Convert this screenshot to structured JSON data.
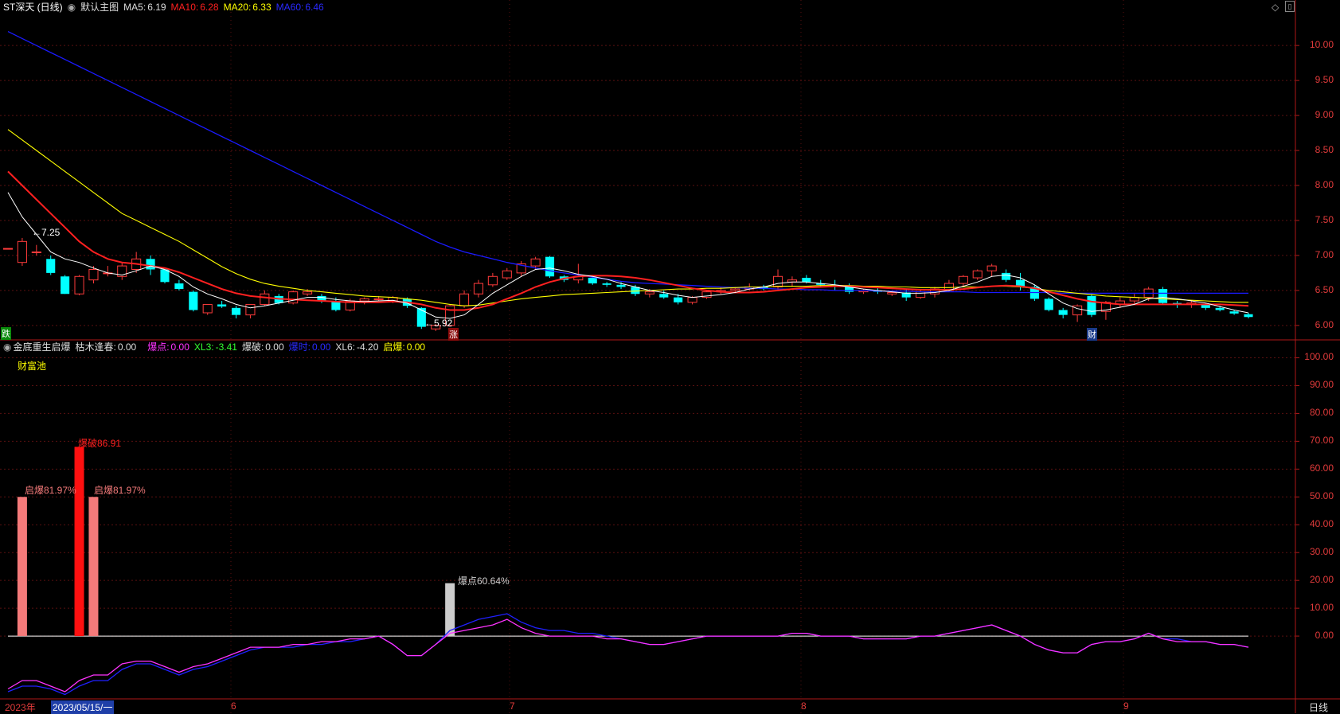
{
  "main_header": {
    "symbol": "ST深天 (日线)",
    "template_label": "默认主图",
    "ma5_label": "MA5:",
    "ma5_value": "6.19",
    "ma10_label": "MA10:",
    "ma10_value": "6.28",
    "ma20_label": "MA20:",
    "ma20_value": "6.33",
    "ma60_label": "MA60:",
    "ma60_value": "6.46"
  },
  "indicator_header": {
    "name": "金底重生启爆",
    "kumu_label": "枯木逢春:",
    "kumu_value": "0.00",
    "baodian_label": "爆点:",
    "baodian_value": "0.00",
    "xl3_label": "XL3:",
    "xl3_value": "-3.41",
    "baopo_label": "爆破:",
    "baopo_value": "0.00",
    "baoshi_label": "爆时:",
    "baoshi_value": "0.00",
    "xl6_label": "XL6:",
    "xl6_value": "-4.20",
    "qibao_label": "启爆:",
    "qibao_value": "0.00",
    "pool_label": "财富池"
  },
  "markers": {
    "high_price": "7.25",
    "low_price": "5.92",
    "left_badge": "跌",
    "zhang_badge": "涨",
    "cai_badge": "财"
  },
  "bar_labels": {
    "qibao1": "启爆81.97%",
    "baopo": "爆破86.91",
    "qibao2": "启爆81.97%",
    "baodian": "爆点60.64%"
  },
  "footer": {
    "year": "2023年",
    "date_cursor": "2023/05/15/一",
    "month6": "6",
    "month7": "7",
    "month8": "8",
    "month9": "9",
    "period": "日线"
  },
  "colors": {
    "up": "#ff3b3b",
    "down": "#00ffff",
    "ma5": "#ffffff",
    "ma10": "#ff2020",
    "ma20": "#ffff00",
    "ma60": "#1a1aff",
    "axis": "#b01818",
    "grid": "#5a1010"
  },
  "chart_data": [
    {
      "type": "candlestick",
      "title": "ST深天 (日线)",
      "y_axis_ticks": [
        "10.00",
        "9.50",
        "9.00",
        "8.50",
        "8.00",
        "7.50",
        "7.00",
        "6.50",
        "6.00"
      ],
      "ylim": [
        5.85,
        10.4
      ],
      "ohlc": [
        [
          7.1,
          7.1,
          7.1,
          7.1
        ],
        [
          6.9,
          7.25,
          6.85,
          7.2
        ],
        [
          7.05,
          7.15,
          7.0,
          7.05
        ],
        [
          6.95,
          7.0,
          6.72,
          6.75
        ],
        [
          6.7,
          6.72,
          6.45,
          6.45
        ],
        [
          6.45,
          6.72,
          6.43,
          6.7
        ],
        [
          6.65,
          6.85,
          6.6,
          6.8
        ],
        [
          6.75,
          6.85,
          6.7,
          6.75
        ],
        [
          6.7,
          6.9,
          6.65,
          6.85
        ],
        [
          6.8,
          7.05,
          6.75,
          6.95
        ],
        [
          6.95,
          7.0,
          6.72,
          6.8
        ],
        [
          6.8,
          6.8,
          6.6,
          6.62
        ],
        [
          6.6,
          6.65,
          6.5,
          6.52
        ],
        [
          6.48,
          6.5,
          6.2,
          6.22
        ],
        [
          6.18,
          6.3,
          6.15,
          6.3
        ],
        [
          6.3,
          6.35,
          6.25,
          6.27
        ],
        [
          6.25,
          6.28,
          6.1,
          6.15
        ],
        [
          6.15,
          6.3,
          6.1,
          6.3
        ],
        [
          6.3,
          6.5,
          6.28,
          6.45
        ],
        [
          6.42,
          6.45,
          6.3,
          6.32
        ],
        [
          6.32,
          6.5,
          6.3,
          6.48
        ],
        [
          6.45,
          6.52,
          6.42,
          6.48
        ],
        [
          6.42,
          6.45,
          6.32,
          6.35
        ],
        [
          6.35,
          6.4,
          6.2,
          6.22
        ],
        [
          6.22,
          6.38,
          6.2,
          6.35
        ],
        [
          6.35,
          6.4,
          6.3,
          6.38
        ],
        [
          6.38,
          6.42,
          6.35,
          6.38
        ],
        [
          6.35,
          6.42,
          6.32,
          6.4
        ],
        [
          6.38,
          6.4,
          6.25,
          6.28
        ],
        [
          6.25,
          6.26,
          5.95,
          5.98
        ],
        [
          5.95,
          6.02,
          5.92,
          6.0
        ],
        [
          6.0,
          6.3,
          5.98,
          6.28
        ],
        [
          6.28,
          6.5,
          6.25,
          6.45
        ],
        [
          6.45,
          6.65,
          6.4,
          6.6
        ],
        [
          6.58,
          6.75,
          6.55,
          6.7
        ],
        [
          6.68,
          6.82,
          6.65,
          6.78
        ],
        [
          6.75,
          6.92,
          6.7,
          6.88
        ],
        [
          6.85,
          6.98,
          6.8,
          6.95
        ],
        [
          6.98,
          6.99,
          6.68,
          6.7
        ],
        [
          6.7,
          6.72,
          6.62,
          6.65
        ],
        [
          6.65,
          6.88,
          6.6,
          6.7
        ],
        [
          6.68,
          6.7,
          6.58,
          6.6
        ],
        [
          6.6,
          6.62,
          6.55,
          6.58
        ],
        [
          6.58,
          6.62,
          6.52,
          6.55
        ],
        [
          6.55,
          6.58,
          6.42,
          6.45
        ],
        [
          6.45,
          6.52,
          6.4,
          6.48
        ],
        [
          6.45,
          6.5,
          6.38,
          6.4
        ],
        [
          6.4,
          6.45,
          6.3,
          6.33
        ],
        [
          6.33,
          6.42,
          6.3,
          6.4
        ],
        [
          6.4,
          6.5,
          6.38,
          6.48
        ],
        [
          6.48,
          6.55,
          6.45,
          6.5
        ],
        [
          6.5,
          6.55,
          6.48,
          6.52
        ],
        [
          6.52,
          6.6,
          6.5,
          6.55
        ],
        [
          6.55,
          6.58,
          6.5,
          6.52
        ],
        [
          6.55,
          6.8,
          6.5,
          6.7
        ],
        [
          6.62,
          6.7,
          6.55,
          6.65
        ],
        [
          6.68,
          6.72,
          6.6,
          6.62
        ],
        [
          6.6,
          6.65,
          6.55,
          6.58
        ],
        [
          6.58,
          6.65,
          6.5,
          6.55
        ],
        [
          6.55,
          6.6,
          6.45,
          6.48
        ],
        [
          6.48,
          6.52,
          6.45,
          6.5
        ],
        [
          6.5,
          6.55,
          6.45,
          6.48
        ],
        [
          6.45,
          6.5,
          6.42,
          6.47
        ],
        [
          6.47,
          6.52,
          6.35,
          6.4
        ],
        [
          6.4,
          6.5,
          6.38,
          6.48
        ],
        [
          6.45,
          6.55,
          6.4,
          6.52
        ],
        [
          6.5,
          6.65,
          6.48,
          6.6
        ],
        [
          6.6,
          6.72,
          6.55,
          6.7
        ],
        [
          6.68,
          6.8,
          6.65,
          6.78
        ],
        [
          6.78,
          6.88,
          6.7,
          6.85
        ],
        [
          6.75,
          6.8,
          6.62,
          6.65
        ],
        [
          6.65,
          6.75,
          6.5,
          6.55
        ],
        [
          6.55,
          6.58,
          6.35,
          6.38
        ],
        [
          6.38,
          6.4,
          6.2,
          6.22
        ],
        [
          6.22,
          6.25,
          6.1,
          6.15
        ],
        [
          6.15,
          6.3,
          6.05,
          6.28
        ],
        [
          6.42,
          6.45,
          6.12,
          6.15
        ],
        [
          6.2,
          6.35,
          6.08,
          6.33
        ],
        [
          6.3,
          6.4,
          6.25,
          6.35
        ],
        [
          6.35,
          6.45,
          6.3,
          6.4
        ],
        [
          6.4,
          6.55,
          6.35,
          6.52
        ],
        [
          6.52,
          6.55,
          6.3,
          6.32
        ],
        [
          6.32,
          6.35,
          6.25,
          6.3
        ],
        [
          6.3,
          6.35,
          6.25,
          6.32
        ],
        [
          6.3,
          6.32,
          6.22,
          6.25
        ],
        [
          6.25,
          6.28,
          6.2,
          6.22
        ],
        [
          6.2,
          6.22,
          6.15,
          6.17
        ],
        [
          6.16,
          6.18,
          6.1,
          6.12
        ]
      ],
      "ma5_approx": [
        7.9,
        7.55,
        7.3,
        7.05,
        6.95,
        6.9,
        6.82,
        6.75,
        6.72,
        6.78,
        6.85,
        6.8,
        6.7,
        6.55,
        6.45,
        6.38,
        6.3,
        6.25,
        6.28,
        6.32,
        6.36,
        6.4,
        6.4,
        6.37,
        6.35,
        6.34,
        6.35,
        6.36,
        6.32,
        6.22,
        6.12,
        6.1,
        6.15,
        6.3,
        6.46,
        6.58,
        6.7,
        6.8,
        6.82,
        6.78,
        6.73,
        6.7,
        6.66,
        6.6,
        6.55,
        6.5,
        6.47,
        6.43,
        6.4,
        6.42,
        6.44,
        6.47,
        6.52,
        6.55,
        6.6,
        6.62,
        6.62,
        6.6,
        6.58,
        6.55,
        6.52,
        6.5,
        6.48,
        6.46,
        6.46,
        6.47,
        6.5,
        6.56,
        6.62,
        6.7,
        6.72,
        6.68,
        6.58,
        6.45,
        6.32,
        6.24,
        6.2,
        6.22,
        6.26,
        6.3,
        6.38,
        6.4,
        6.38,
        6.35,
        6.32,
        6.27,
        6.22,
        6.18
      ],
      "ma10_approx": [
        8.2,
        8.0,
        7.8,
        7.6,
        7.4,
        7.2,
        7.05,
        6.95,
        6.9,
        6.88,
        6.85,
        6.82,
        6.76,
        6.68,
        6.6,
        6.52,
        6.46,
        6.42,
        6.4,
        6.38,
        6.37,
        6.36,
        6.35,
        6.34,
        6.33,
        6.33,
        6.33,
        6.34,
        6.33,
        6.3,
        6.25,
        6.22,
        6.22,
        6.25,
        6.3,
        6.38,
        6.46,
        6.55,
        6.62,
        6.67,
        6.7,
        6.71,
        6.71,
        6.7,
        6.68,
        6.65,
        6.61,
        6.57,
        6.53,
        6.5,
        6.48,
        6.47,
        6.47,
        6.48,
        6.5,
        6.52,
        6.54,
        6.55,
        6.56,
        6.56,
        6.55,
        6.54,
        6.53,
        6.52,
        6.51,
        6.51,
        6.51,
        6.52,
        6.54,
        6.56,
        6.57,
        6.56,
        6.53,
        6.48,
        6.43,
        6.38,
        6.34,
        6.32,
        6.3,
        6.3,
        6.3,
        6.3,
        6.3,
        6.3,
        6.3,
        6.3,
        6.29,
        6.28
      ],
      "ma20_approx": [
        8.8,
        8.65,
        8.5,
        8.35,
        8.2,
        8.05,
        7.9,
        7.75,
        7.6,
        7.5,
        7.4,
        7.3,
        7.2,
        7.08,
        6.96,
        6.84,
        6.74,
        6.66,
        6.6,
        6.56,
        6.53,
        6.5,
        6.48,
        6.46,
        6.44,
        6.42,
        6.41,
        6.4,
        6.38,
        6.36,
        6.33,
        6.3,
        6.28,
        6.29,
        6.32,
        6.35,
        6.38,
        6.4,
        6.42,
        6.44,
        6.45,
        6.46,
        6.47,
        6.48,
        6.49,
        6.5,
        6.51,
        6.52,
        6.52,
        6.53,
        6.53,
        6.54,
        6.55,
        6.55,
        6.56,
        6.56,
        6.56,
        6.57,
        6.57,
        6.57,
        6.56,
        6.56,
        6.55,
        6.55,
        6.54,
        6.54,
        6.54,
        6.55,
        6.55,
        6.56,
        6.56,
        6.55,
        6.53,
        6.5,
        6.48,
        6.46,
        6.44,
        6.42,
        6.41,
        6.4,
        6.39,
        6.38,
        6.37,
        6.36,
        6.35,
        6.34,
        6.33,
        6.33
      ],
      "ma60_approx": [
        10.2,
        10.1,
        10.0,
        9.9,
        9.8,
        9.7,
        9.6,
        9.5,
        9.4,
        9.3,
        9.2,
        9.1,
        9.0,
        8.9,
        8.8,
        8.7,
        8.6,
        8.5,
        8.4,
        8.3,
        8.2,
        8.1,
        8.0,
        7.9,
        7.8,
        7.7,
        7.6,
        7.5,
        7.4,
        7.3,
        7.2,
        7.12,
        7.05,
        7.0,
        6.95,
        6.9,
        6.86,
        6.82,
        6.78,
        6.75,
        6.72,
        6.69,
        6.66,
        6.63,
        6.61,
        6.6,
        6.59,
        6.58,
        6.57,
        6.56,
        6.55,
        6.54,
        6.53,
        6.53,
        6.52,
        6.52,
        6.51,
        6.51,
        6.5,
        6.5,
        6.5,
        6.49,
        6.49,
        6.49,
        6.48,
        6.48,
        6.48,
        6.48,
        6.47,
        6.47,
        6.47,
        6.47,
        6.47,
        6.47,
        6.46,
        6.46,
        6.46,
        6.46,
        6.46,
        6.46,
        6.46,
        6.46,
        6.46,
        6.46,
        6.46,
        6.46,
        6.46,
        6.46
      ]
    },
    {
      "type": "bar",
      "title": "金底重生启爆",
      "y_axis_ticks": [
        "100.00",
        "90.00",
        "80.00",
        "70.00",
        "60.00",
        "50.00",
        "40.00",
        "30.00",
        "20.00",
        "10.00",
        "0.00"
      ],
      "ylim": [
        -22,
        105
      ],
      "bars": [
        {
          "index": 1,
          "value": 50,
          "label": "启爆81.97%",
          "color": "#f47a7a"
        },
        {
          "index": 5,
          "value": 68,
          "label": "爆破86.91",
          "color": "#ff1010"
        },
        {
          "index": 6,
          "value": 50,
          "label": "启爆81.97%",
          "color": "#f47a7a"
        },
        {
          "index": 31,
          "value": 19,
          "label": "爆点60.64%",
          "color": "#cccccc"
        }
      ],
      "xl3_approx": [
        -19,
        -16,
        -16,
        -18,
        -20,
        -16,
        -14,
        -14,
        -10,
        -9,
        -9,
        -11,
        -13,
        -11,
        -10,
        -8,
        -6,
        -4,
        -4,
        -4,
        -3,
        -3,
        -2,
        -2,
        -1,
        -1,
        0,
        -3,
        -7,
        -7,
        -3,
        1,
        2,
        3,
        4,
        6,
        3,
        1,
        0,
        0,
        0,
        0,
        -1,
        -1,
        -2,
        -3,
        -3,
        -2,
        -1,
        0,
        0,
        0,
        0,
        0,
        0,
        1,
        1,
        0,
        0,
        0,
        -1,
        -1,
        -1,
        -1,
        0,
        0,
        1,
        2,
        3,
        4,
        2,
        0,
        -3,
        -5,
        -6,
        -6,
        -3,
        -2,
        -2,
        -1,
        1,
        -1,
        -2,
        -2,
        -2,
        -3,
        -3,
        -4
      ],
      "xl6_approx": [
        -20,
        -18,
        -18,
        -19,
        -21,
        -18,
        -16,
        -16,
        -12,
        -10,
        -10,
        -12,
        -14,
        -12,
        -11,
        -9,
        -7,
        -5,
        -4,
        -4,
        -4,
        -3,
        -3,
        -2,
        -2,
        -1,
        0,
        -3,
        -7,
        -7,
        -3,
        2,
        4,
        6,
        7,
        8,
        5,
        3,
        2,
        2,
        1,
        1,
        0,
        -1,
        -2,
        -3,
        -3,
        -2,
        -1,
        0,
        0,
        0,
        0,
        0,
        0,
        1,
        1,
        0,
        0,
        0,
        -1,
        -1,
        -1,
        -1,
        0,
        0,
        1,
        2,
        3,
        4,
        2,
        0,
        -3,
        -5,
        -6,
        -6,
        -3,
        -2,
        -2,
        -1,
        1,
        -1,
        -1,
        -2,
        -2,
        -3,
        -3,
        -4
      ]
    }
  ]
}
